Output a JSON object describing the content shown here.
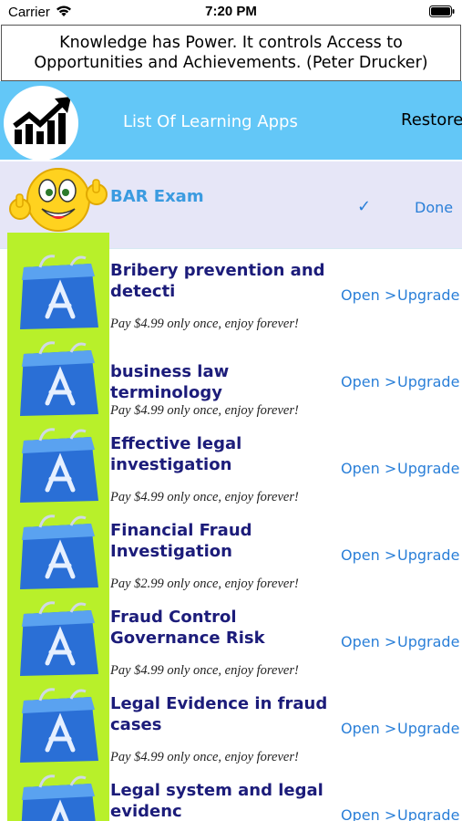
{
  "status_bar": {
    "carrier": "Carrier",
    "time": "7:20 PM"
  },
  "quote": "Knowledge has Power. It controls Access to Opportunities and Achievements. (Peter Drucker)",
  "header": {
    "title": "List Of Learning Apps",
    "restore_label": "Restore"
  },
  "colors": {
    "header_bg": "#63c7f7",
    "thumb_bg": "#b8f02a",
    "link": "#2a7fd8",
    "title": "#1c1c7a"
  },
  "rows": [
    {
      "title": "BAR Exam",
      "check": "✓",
      "done": "Done",
      "icon": "smiley-thumbs-up-icon"
    },
    {
      "title": "Bribery prevention and detecti",
      "price": "Pay $4.99 only once, enjoy forever!",
      "open": "Open >",
      "upgrade": "Upgrade >",
      "icon": "app-store-bag-icon"
    },
    {
      "title": "business law terminology",
      "price": "Pay $4.99 only once, enjoy forever!",
      "open": "Open >",
      "upgrade": "Upgrade >",
      "icon": "app-store-bag-icon"
    },
    {
      "title": "Effective legal investigation",
      "price": "Pay $4.99 only once, enjoy forever!",
      "open": "Open >",
      "upgrade": "Upgrade >",
      "icon": "app-store-bag-icon"
    },
    {
      "title": "Financial Fraud Investigation",
      "price": "Pay $2.99 only once, enjoy forever!",
      "open": "Open >",
      "upgrade": "Upgrade >",
      "icon": "app-store-bag-icon"
    },
    {
      "title": "Fraud Control Governance Risk",
      "price": "Pay $4.99 only once, enjoy forever!",
      "open": "Open >",
      "upgrade": "Upgrade >",
      "icon": "app-store-bag-icon"
    },
    {
      "title": "Legal Evidence in fraud cases",
      "price": "Pay $4.99 only once, enjoy forever!",
      "open": "Open >",
      "upgrade": "Upgrade >",
      "icon": "app-store-bag-icon"
    },
    {
      "title": "Legal system and legal evidenc",
      "price": "",
      "open": "Open >",
      "upgrade": "Upgrade >",
      "icon": "app-store-bag-icon"
    }
  ]
}
